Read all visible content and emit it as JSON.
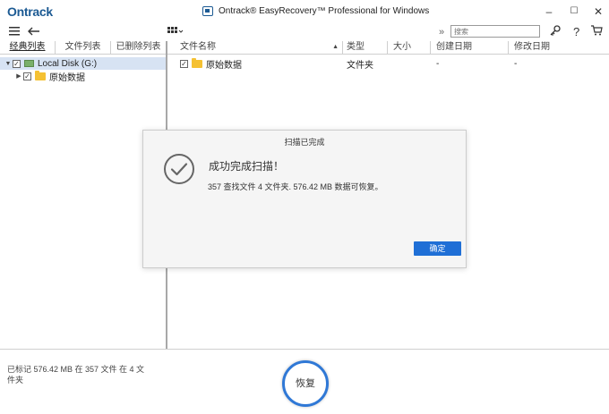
{
  "app": {
    "logo": "Ontrack",
    "title": "Ontrack® EasyRecovery™ Professional for Windows",
    "minimize": "–",
    "maximize": "☐",
    "close": "✕"
  },
  "toolbar": {
    "menu_icon": "menu-icon",
    "back_icon": "back-arrow-icon",
    "view_icon": "grid-view-icon",
    "search_placeholder": "搜索",
    "expand_icon": "double-chevron-icon",
    "key_icon": "key-icon",
    "help_icon": "help-icon",
    "cart_icon": "cart-icon"
  },
  "left_tabs": [
    {
      "label": "经典列表",
      "active": true
    },
    {
      "label": "文件列表",
      "active": false
    },
    {
      "label": "已删除列表",
      "active": false
    }
  ],
  "tree": {
    "root": {
      "label": "Local Disk (G:)",
      "checked": true,
      "expanded": true
    },
    "child": {
      "label": "原始数据",
      "checked": true,
      "expanded": false
    }
  },
  "columns": [
    {
      "label": "文件名称",
      "sort": "▲"
    },
    {
      "label": "类型"
    },
    {
      "label": "大小"
    },
    {
      "label": "创建日期"
    },
    {
      "label": "修改日期"
    }
  ],
  "files": [
    {
      "name": "原始数据",
      "type": "文件夹",
      "size": "",
      "created": "-",
      "modified": "-",
      "checked": true
    }
  ],
  "status": {
    "summary": "已标记 576.42 MB 在 357 文件 在 4 文件夹",
    "recover_label": "恢复"
  },
  "dialog": {
    "title": "扫描已完成",
    "heading": "成功完成扫描！",
    "message": "357 查找文件 4 文件夹. 576.42 MB 数据可恢复。",
    "ok_label": "确定",
    "check_icon": "check-circle-icon",
    "colors": {
      "ok_button": "#1f6fd6",
      "check": "#666666"
    }
  },
  "colors": {
    "accent": "#2f78d6",
    "brand": "#1c5a93",
    "selection": "#d7e3f3",
    "folder": "#f5c133"
  }
}
